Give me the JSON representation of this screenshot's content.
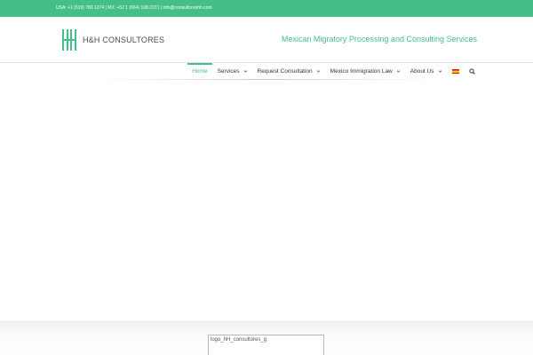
{
  "topbar": {
    "contact": "USA: +1 (619) 780.1274 | MX: +52 1 (664) 108.2371 | info@consultoreshh.com"
  },
  "header": {
    "logo_text": "H&H CONSULTORES",
    "tagline": "Mexican Migratory Processing and Consulting Services",
    "logo_icon": "hh-monogram-icon",
    "brand_color": "#44bf87"
  },
  "nav": {
    "items": [
      {
        "label": "Home",
        "active": true,
        "has_dropdown": false
      },
      {
        "label": "Services",
        "active": false,
        "has_dropdown": true
      },
      {
        "label": "Request Consultation",
        "active": false,
        "has_dropdown": true
      },
      {
        "label": "Mexico Immigration Law",
        "active": false,
        "has_dropdown": true
      },
      {
        "label": "About Us",
        "active": false,
        "has_dropdown": true
      }
    ],
    "language_icon": "spain-flag-icon",
    "search_icon": "search-icon"
  },
  "footer": {
    "image_alt": "logo_hH_consultores_g"
  }
}
